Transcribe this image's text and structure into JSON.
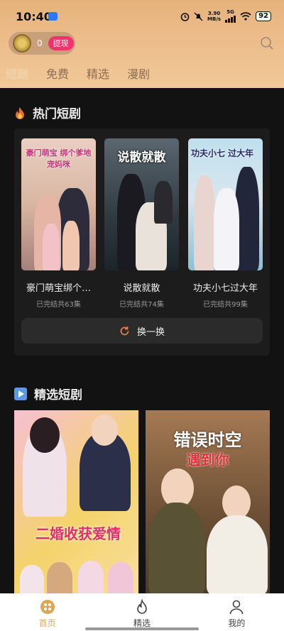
{
  "status_bar": {
    "time": "10:40",
    "speed_value": "3.90",
    "speed_unit": "MB/s",
    "network": "5G",
    "battery": "92"
  },
  "header": {
    "coin_count": "0",
    "withdraw_label": "提现",
    "search_icon": "search-icon"
  },
  "tabs": [
    {
      "label": "短剧",
      "active": true
    },
    {
      "label": "免费",
      "active": false
    },
    {
      "label": "精选",
      "active": false
    },
    {
      "label": "漫剧",
      "active": false
    }
  ],
  "hot_section": {
    "title": "热门短剧",
    "items": [
      {
        "poster_title": "豪门萌宝 绑个爹地宠妈咪",
        "name": "豪门萌宝绑个…",
        "status": "已完结共63集"
      },
      {
        "poster_title": "说散就散",
        "name": "说散就散",
        "status": "已完结共74集"
      },
      {
        "poster_title": "功夫小七 过大年",
        "name": "功夫小七过大年",
        "status": "已完结共99集"
      }
    ],
    "refresh_label": "换一换"
  },
  "featured_section": {
    "title": "精选短剧",
    "items": [
      {
        "poster_title": "二婚收获爱情"
      },
      {
        "poster_title": "错误时空",
        "poster_subtitle": "遇到你"
      }
    ]
  },
  "bottom_nav": [
    {
      "label": "首页",
      "icon": "home-icon",
      "active": true
    },
    {
      "label": "精选",
      "icon": "flame-icon",
      "active": false
    },
    {
      "label": "我的",
      "icon": "profile-icon",
      "active": false
    }
  ],
  "colors": {
    "accent": "#e0a455",
    "header_bg": "#e6b27c",
    "withdraw": "#f0336b",
    "background": "#121212"
  }
}
